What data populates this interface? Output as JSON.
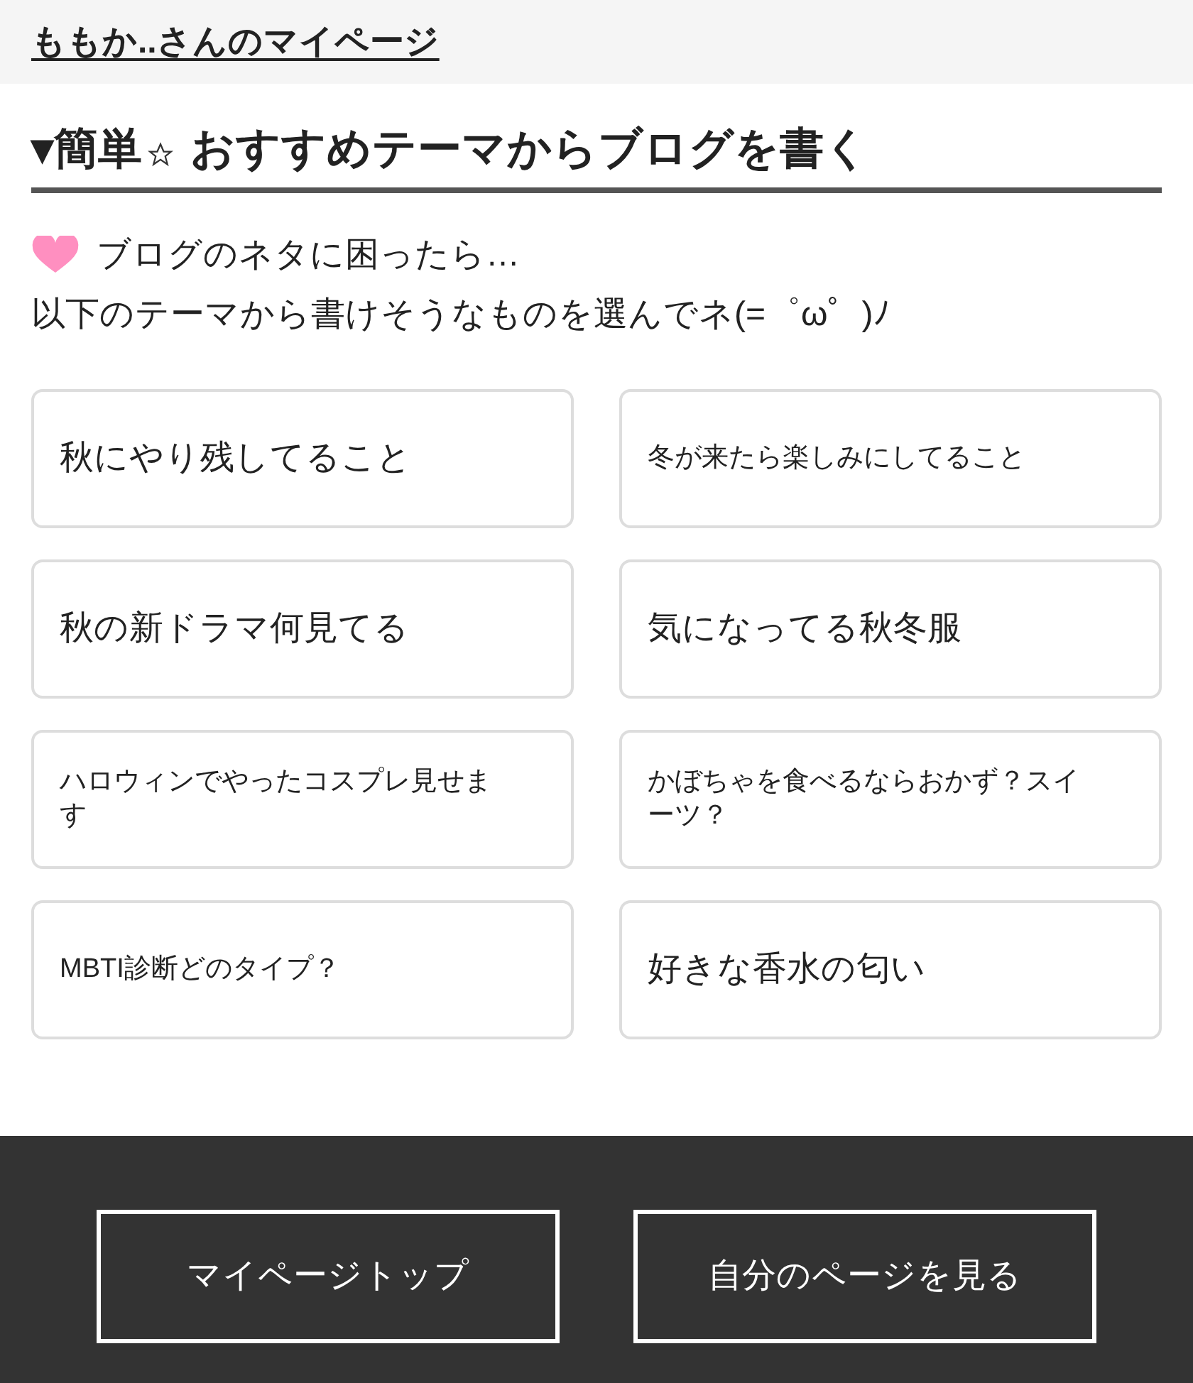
{
  "header": {
    "link": "ももか..さんのマイページ"
  },
  "heading": {
    "marker": "▾",
    "word": "簡単",
    "title": "おすすめテーマからブログを書く"
  },
  "intro": [
    "ブログのネタに困ったら…",
    "以下のテーマから書けそうなものを選んでネ(=゜ω゜)ﾉ"
  ],
  "themes": [
    {
      "label": "秋にやり残してること",
      "kind": "large"
    },
    {
      "label": "冬が来たら楽しみにしてること",
      "kind": "small"
    },
    {
      "label": "秋の新ドラマ何見てる",
      "kind": "large"
    },
    {
      "label": "気になってる秋冬服",
      "kind": "large"
    },
    {
      "label": "ハロウィンでやったコスプレ見せます",
      "kind": "small"
    },
    {
      "label": "かぼちゃを食べるならおかず？スイーツ？",
      "kind": "small"
    },
    {
      "label": "MBTI診断どのタイプ？",
      "kind": "small"
    },
    {
      "label": "好きな香水の匂い",
      "kind": "large"
    }
  ],
  "footer_buttons": [
    "マイページトップ",
    "自分のページを見る"
  ]
}
